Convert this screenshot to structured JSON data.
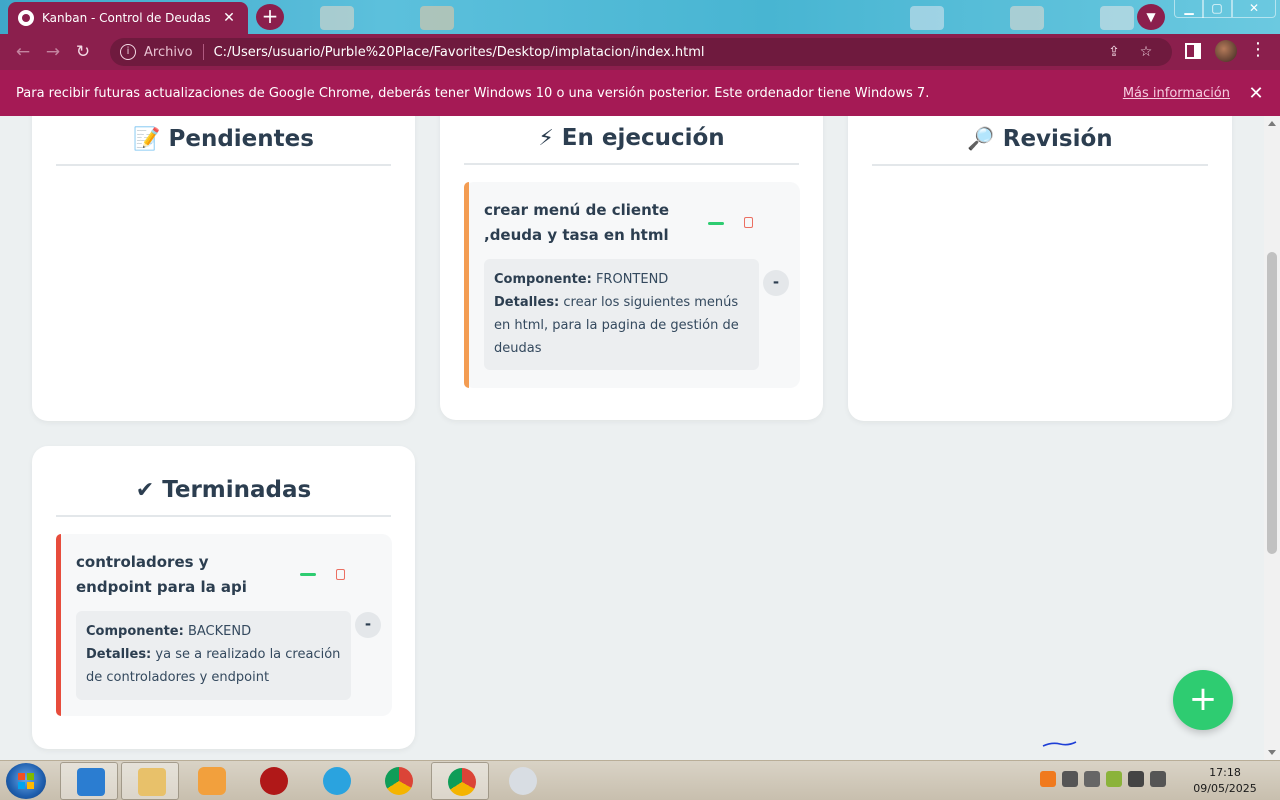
{
  "browser": {
    "tab_title": "Kanban - Control de Deudas",
    "tab_close": "✕",
    "new_tab": "+",
    "omnibox_scheme": "Archivo",
    "url": "C:/Users/usuario/Purble%20Place/Favorites/Desktop/implatacion/index.html",
    "infobar_message": "Para recibir futuras actualizaciones de Google Chrome, deberás tener Windows 10 o una versión posterior. Este ordenador tiene Windows 7.",
    "infobar_link": "Más información",
    "infobar_close": "✕"
  },
  "board": {
    "columns": [
      {
        "title": "Pendientes",
        "icon": "memo-icon"
      },
      {
        "title": "En ejecución",
        "icon": "lightning-icon"
      },
      {
        "title": "Revisión",
        "icon": "magnifier-icon"
      },
      {
        "title": "Terminadas",
        "icon": "check-icon"
      }
    ],
    "cards": [
      {
        "column": "En ejecución",
        "title": "crear menú de cliente ,deuda y tasa en html",
        "component_label": "Componente:",
        "component": "FRONTEND",
        "details_label": "Detalles:",
        "details": "crear los siguientes menús en html, para la pagina de gestión de deudas",
        "toggle": "-",
        "accent": "#f39c52"
      },
      {
        "column": "Terminadas",
        "title": "controladores y endpoint para la api",
        "component_label": "Componente:",
        "component": "BACKEND",
        "details_label": "Detalles:",
        "details": "ya se a realizado la creación de controladores y endpoint",
        "toggle": "-",
        "accent": "#e74c3c"
      }
    ],
    "add_button": "+"
  },
  "taskbar": {
    "time": "17:18",
    "date": "09/05/2025"
  },
  "colors": {
    "chrome_theme": "#8b1f4d",
    "infobar": "#a51a55",
    "fab": "#2ecc71",
    "page_bg": "#ecf0f1"
  }
}
